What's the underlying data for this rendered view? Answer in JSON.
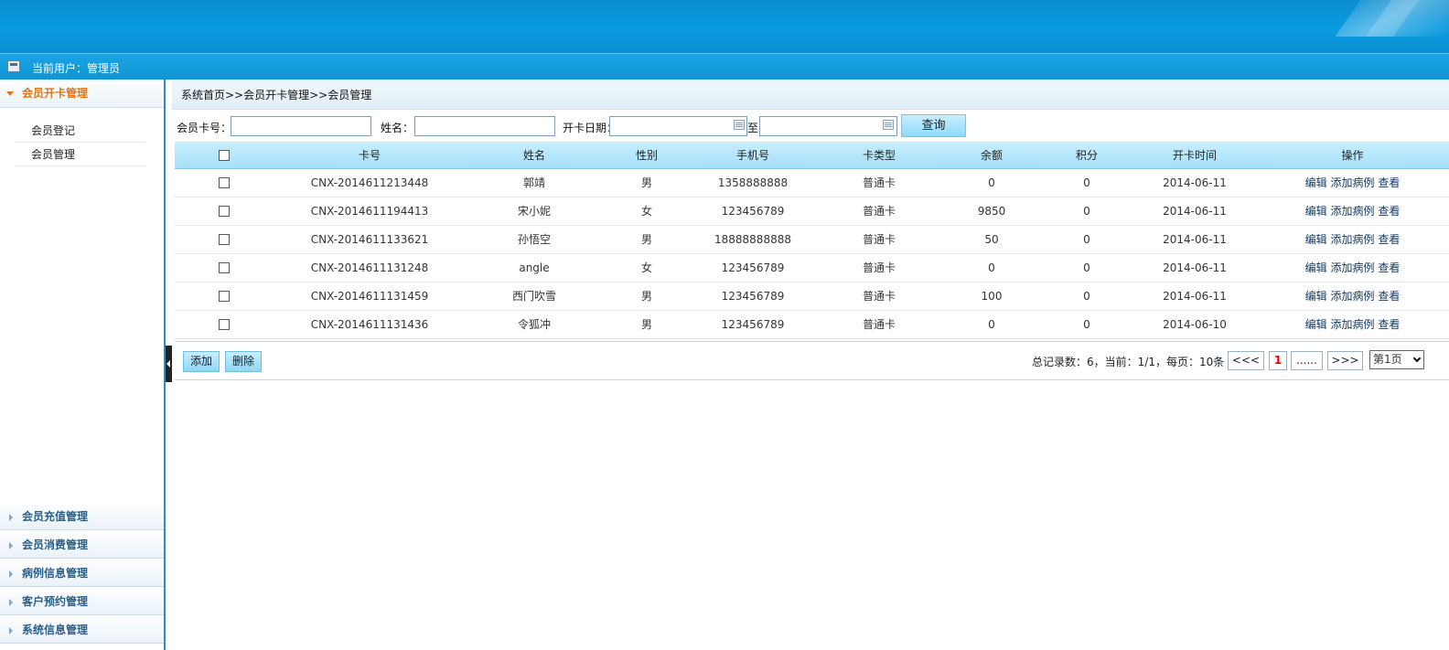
{
  "user": {
    "label": "当前用户：管理员"
  },
  "sidebar": {
    "active": {
      "label": "会员开卡管理",
      "items": [
        {
          "label": "会员登记"
        },
        {
          "label": "会员管理"
        }
      ]
    },
    "others": [
      {
        "label": "会员充值管理"
      },
      {
        "label": "会员消费管理"
      },
      {
        "label": "病例信息管理"
      },
      {
        "label": "客户预约管理"
      },
      {
        "label": "系统信息管理"
      }
    ]
  },
  "breadcrumb": "系统首页>>会员开卡管理>>会员管理",
  "search": {
    "card_label": "会员卡号：",
    "name_label": "姓名：",
    "date_label": "开卡日期：",
    "to_label": "至",
    "query_label": "查询",
    "card_value": "",
    "name_value": "",
    "date_from": "",
    "date_to": ""
  },
  "table": {
    "headers": [
      "卡号",
      "姓名",
      "性别",
      "手机号",
      "卡类型",
      "余额",
      "积分",
      "开卡时间",
      "操作"
    ],
    "op_labels": [
      "编辑",
      "添加病例",
      "查看"
    ],
    "rows": [
      [
        "CNX-2014611213448",
        "郭靖",
        "男",
        "1358888888",
        "普通卡",
        "0",
        "0",
        "2014-06-11"
      ],
      [
        "CNX-2014611194413",
        "宋小妮",
        "女",
        "123456789",
        "普通卡",
        "9850",
        "0",
        "2014-06-11"
      ],
      [
        "CNX-2014611133621",
        "孙悟空",
        "男",
        "18888888888",
        "普通卡",
        "50",
        "0",
        "2014-06-11"
      ],
      [
        "CNX-2014611131248",
        "angle",
        "女",
        "123456789",
        "普通卡",
        "0",
        "0",
        "2014-06-11"
      ],
      [
        "CNX-2014611131459",
        "西门吹雪",
        "男",
        "123456789",
        "普通卡",
        "100",
        "0",
        "2014-06-11"
      ],
      [
        "CNX-2014611131436",
        "令狐冲",
        "男",
        "123456789",
        "普通卡",
        "0",
        "0",
        "2014-06-10"
      ]
    ]
  },
  "actions": {
    "add": "添加",
    "delete": "删除"
  },
  "pager": {
    "summary": "总记录数：6，当前：1/1，每页：10条",
    "prev": "<<<",
    "current": "1",
    "ellipsis": "......",
    "next": ">>>",
    "select": "第1页"
  }
}
